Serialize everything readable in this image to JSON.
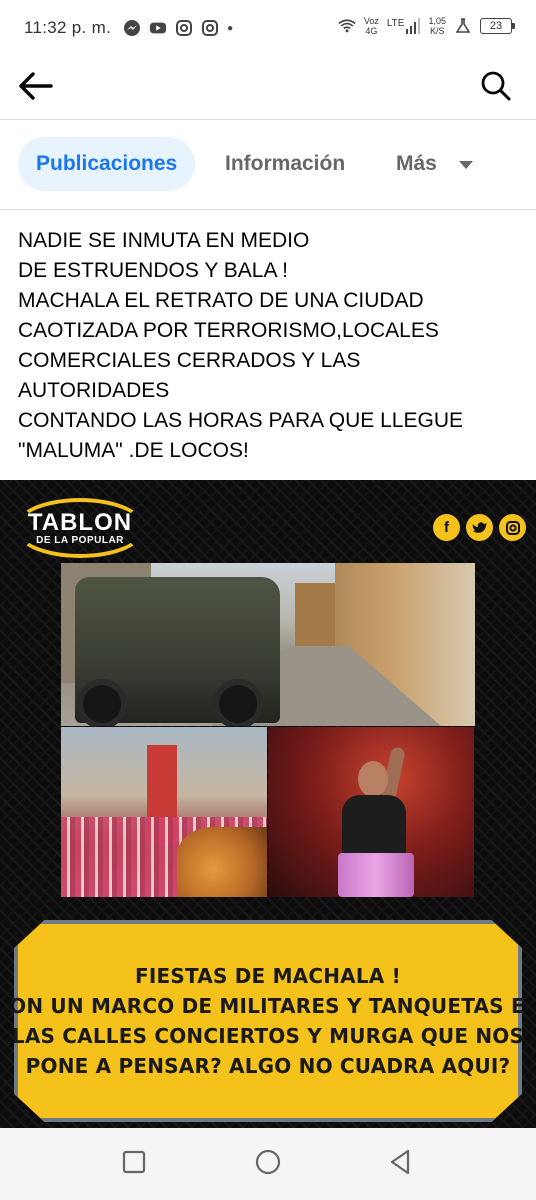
{
  "status_bar": {
    "time": "11:32 p. m.",
    "notification_icons": [
      "messenger-icon",
      "youtube-icon",
      "instagram-icon",
      "instagram-icon"
    ],
    "network_label_top": "Voz",
    "network_label_bottom": "4G",
    "lte_label": "LTE",
    "speed_value": "1,05",
    "speed_unit": "K/S",
    "battery_level": "23"
  },
  "app_bar": {
    "back_icon": "arrow-left-icon",
    "search_icon": "search-icon"
  },
  "tabs": {
    "items": [
      {
        "label": "Publicaciones",
        "active": true
      },
      {
        "label": "Información",
        "active": false
      },
      {
        "label": "Más",
        "active": false
      }
    ],
    "active_color": "#1877f2",
    "active_bg": "#e7f3ff"
  },
  "post": {
    "lines": [
      "NADIE SE INMUTA EN MEDIO",
      "DE ESTRUENDOS Y BALA !",
      "MACHALA EL RETRATO DE UNA CIUDAD",
      "CAOTIZADA POR TERRORISMO,LOCALES",
      "COMERCIALES CERRADOS Y LAS",
      "AUTORIDADES",
      "CONTANDO LAS HORAS PARA QUE LLEGUE",
      "\"MALUMA\" .DE LOCOS!"
    ]
  },
  "image": {
    "logo_main": "TABLON",
    "logo_sub": "DE LA POPULAR",
    "social_icons": [
      "facebook-icon",
      "twitter-icon",
      "instagram-icon"
    ],
    "caption_lines": [
      "FIESTAS DE MACHALA !",
      "CON UN MARCO DE MILITARES Y TANQUETAS EN",
      "LAS CALLES CONCIERTOS Y MURGA QUE NOS",
      "PONE A PENSAR? ALGO NO CUADRA AQUI?"
    ],
    "accent_color": "#f4c21a"
  },
  "nav_bar": {
    "icons": [
      "recents-square-icon",
      "home-circle-icon",
      "back-triangle-icon"
    ]
  }
}
